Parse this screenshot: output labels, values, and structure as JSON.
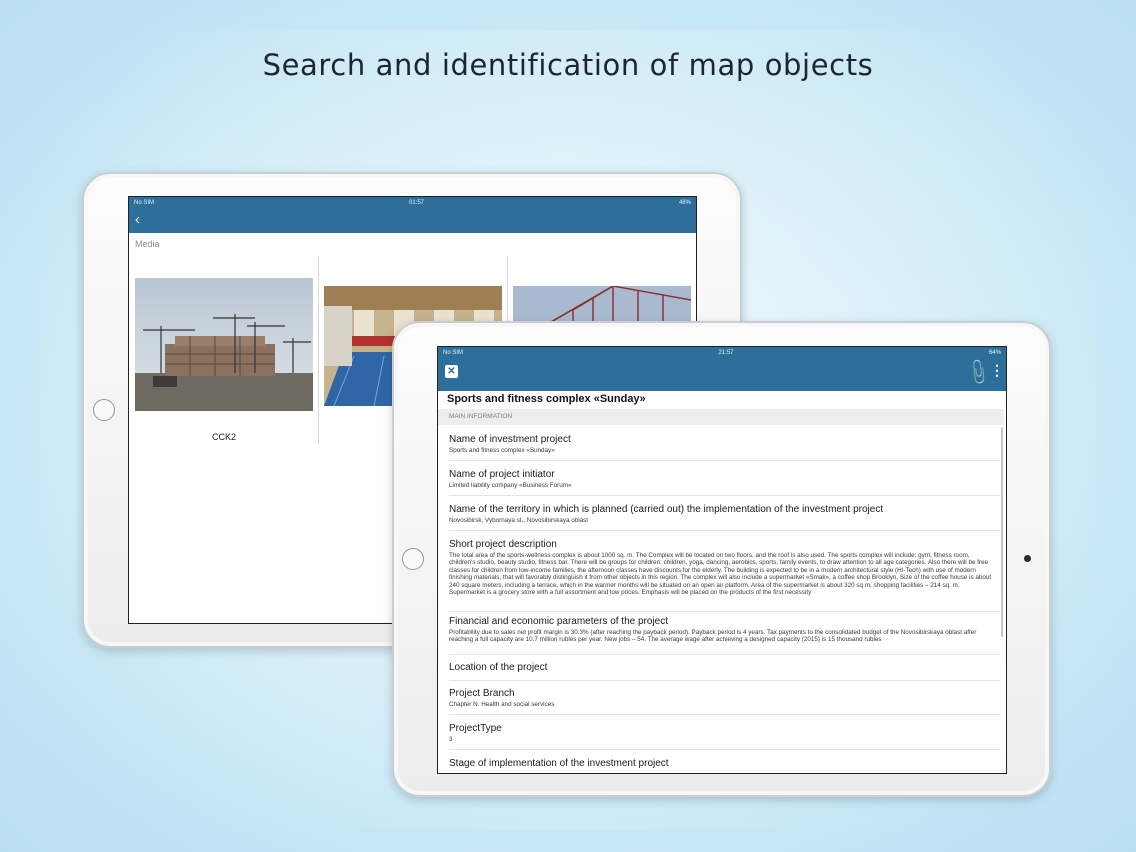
{
  "headline": "Search and identification of map objects",
  "back_device": {
    "status": {
      "carrier": "No SIM",
      "time": "01:57",
      "battery": "48%"
    },
    "nav": {
      "back_label": "‹"
    },
    "media_label": "Media",
    "items": [
      {
        "caption": "CCK2"
      },
      {
        "caption": ""
      },
      {
        "caption": ""
      }
    ]
  },
  "front_device": {
    "status": {
      "carrier": "No SIM",
      "time": "21:57",
      "battery": "64%"
    },
    "nav": {
      "close": "✕"
    },
    "title": "Sports and fitness complex «Sunday»",
    "section": "MAIN INFORMATION",
    "fields": [
      {
        "label": "Name of investment project",
        "value": "Sports and fitness complex «Sunday»"
      },
      {
        "label": "Name of project initiator",
        "value": "Limited liability company «Business Forum»"
      },
      {
        "label": "Name of the territory in which is planned (carried out) the implementation of the investment project",
        "value": "Novosibirsk, Vybornaya st., Novosibirskaya oblast"
      },
      {
        "label": "Short project description",
        "value": "The total area of the sports-wellness complex is about 1000 sq. m. The Complex will be located on two floors, and the roof is also used. The sports complex will include: gym, fitness room, children's studio, beauty studio, fitness bar. There will be groups for children: children, yoga, dancing, aerobics, sports, family events, to draw attention to all age categories. Also there will be free classes for children from low-income families, the afternoon classes have discounts for the elderly. The building is expected to be in a modern architectural style (HI-Tech) with use of modern finishing materials, that will favorably distinguish it from other objects in this region. The complex will also include a supermarket «Smak», a coffee shop Brooklyn. Size of the coffee house is about 240 square meters, including a terrace, which in the warmer months will be situated on an open air platform. Area of the supermarket is about 320 sq m, shopping facilities – 214 sq. m. Supermarket is a grocery store with a full assortment and low prices. Emphasis will be placed on the products of the first necessity"
      },
      {
        "label": "Financial and economic parameters of the project",
        "value": "Profitability due to sales net profit margin is 30.3% (after reaching the payback period). Payback period is 4 years. Tax payments to the consolidated budget of the Novosibirskaya oblast after reaching a full capacity are 10.7 million rubles per year. New jobs – 54. The average wage after achieving a designed capacity (2015) is 15 thousand rubles"
      },
      {
        "label": "Location of the project",
        "value": ""
      },
      {
        "label": "Project Branch",
        "value": "Chapter N. Health and social services"
      },
      {
        "label": "ProjectType",
        "value": "3"
      },
      {
        "label": "Stage of implementation of the investment project",
        "value": ""
      }
    ]
  },
  "colors": {
    "nav_blue": "#2e6e9b",
    "background": "#cdeaf7"
  }
}
